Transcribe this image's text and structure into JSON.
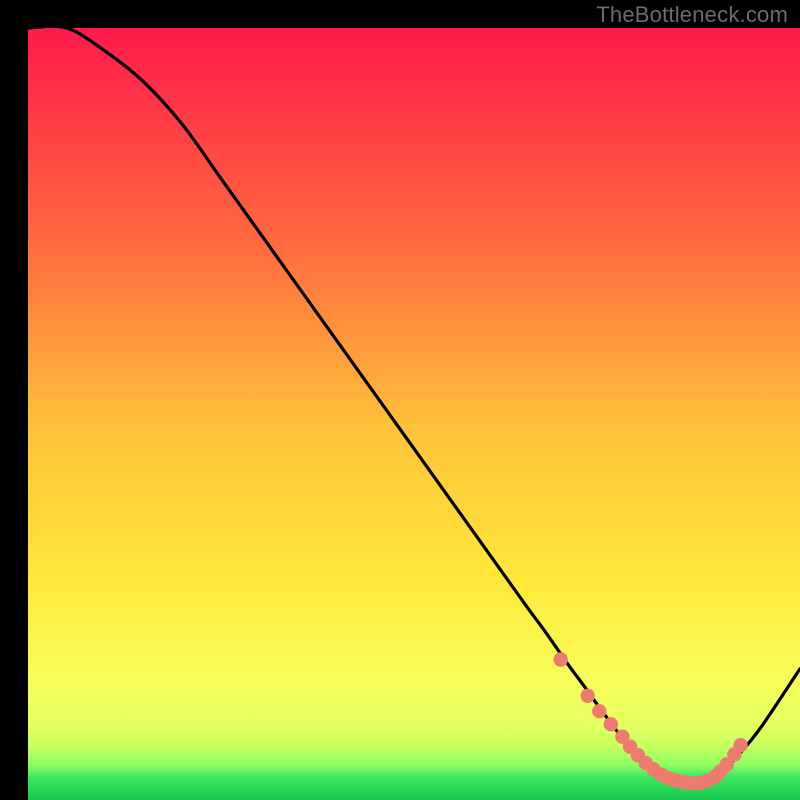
{
  "watermark": "TheBottleneck.com",
  "colors": {
    "bg": "#000000",
    "curve": "#000000",
    "dot": "#ee7b6f",
    "grad_top": "#ff1a4b",
    "grad_mid1": "#ff8a3a",
    "grad_mid2": "#ffe23a",
    "grad_low": "#f8ff6a",
    "grad_band": "#d8ff66",
    "grad_green": "#1fdf62"
  },
  "chart_data": {
    "type": "line",
    "title": "",
    "xlabel": "",
    "ylabel": "",
    "xlim": [
      0,
      100
    ],
    "ylim": [
      0,
      100
    ],
    "x": [
      0,
      5,
      10,
      15,
      20,
      25,
      30,
      35,
      40,
      45,
      50,
      55,
      60,
      63,
      65,
      67,
      70,
      72,
      74,
      76,
      78,
      80,
      82,
      84,
      86,
      88,
      90,
      92,
      95,
      100
    ],
    "curve": [
      100,
      100,
      97,
      93,
      87.5,
      80.5,
      73.5,
      66.5,
      59.5,
      52.5,
      45.5,
      38.5,
      31.5,
      27.3,
      24.5,
      21.8,
      17.5,
      14.8,
      12,
      9.3,
      6.8,
      4.7,
      3.2,
      2.4,
      2.2,
      2.6,
      3.8,
      5.8,
      9.5,
      17
    ],
    "dots_x": [
      69,
      72.5,
      74,
      75.5,
      77,
      78,
      79,
      80,
      81,
      82,
      83,
      84,
      85,
      86,
      87,
      88,
      89,
      89.7,
      90.5,
      91.5,
      92.3
    ],
    "dots_y": [
      18.2,
      13.5,
      11.5,
      9.8,
      8.2,
      6.9,
      5.8,
      4.8,
      4.0,
      3.3,
      2.8,
      2.5,
      2.3,
      2.2,
      2.2,
      2.5,
      3.0,
      3.7,
      4.6,
      5.9,
      7.1
    ]
  }
}
